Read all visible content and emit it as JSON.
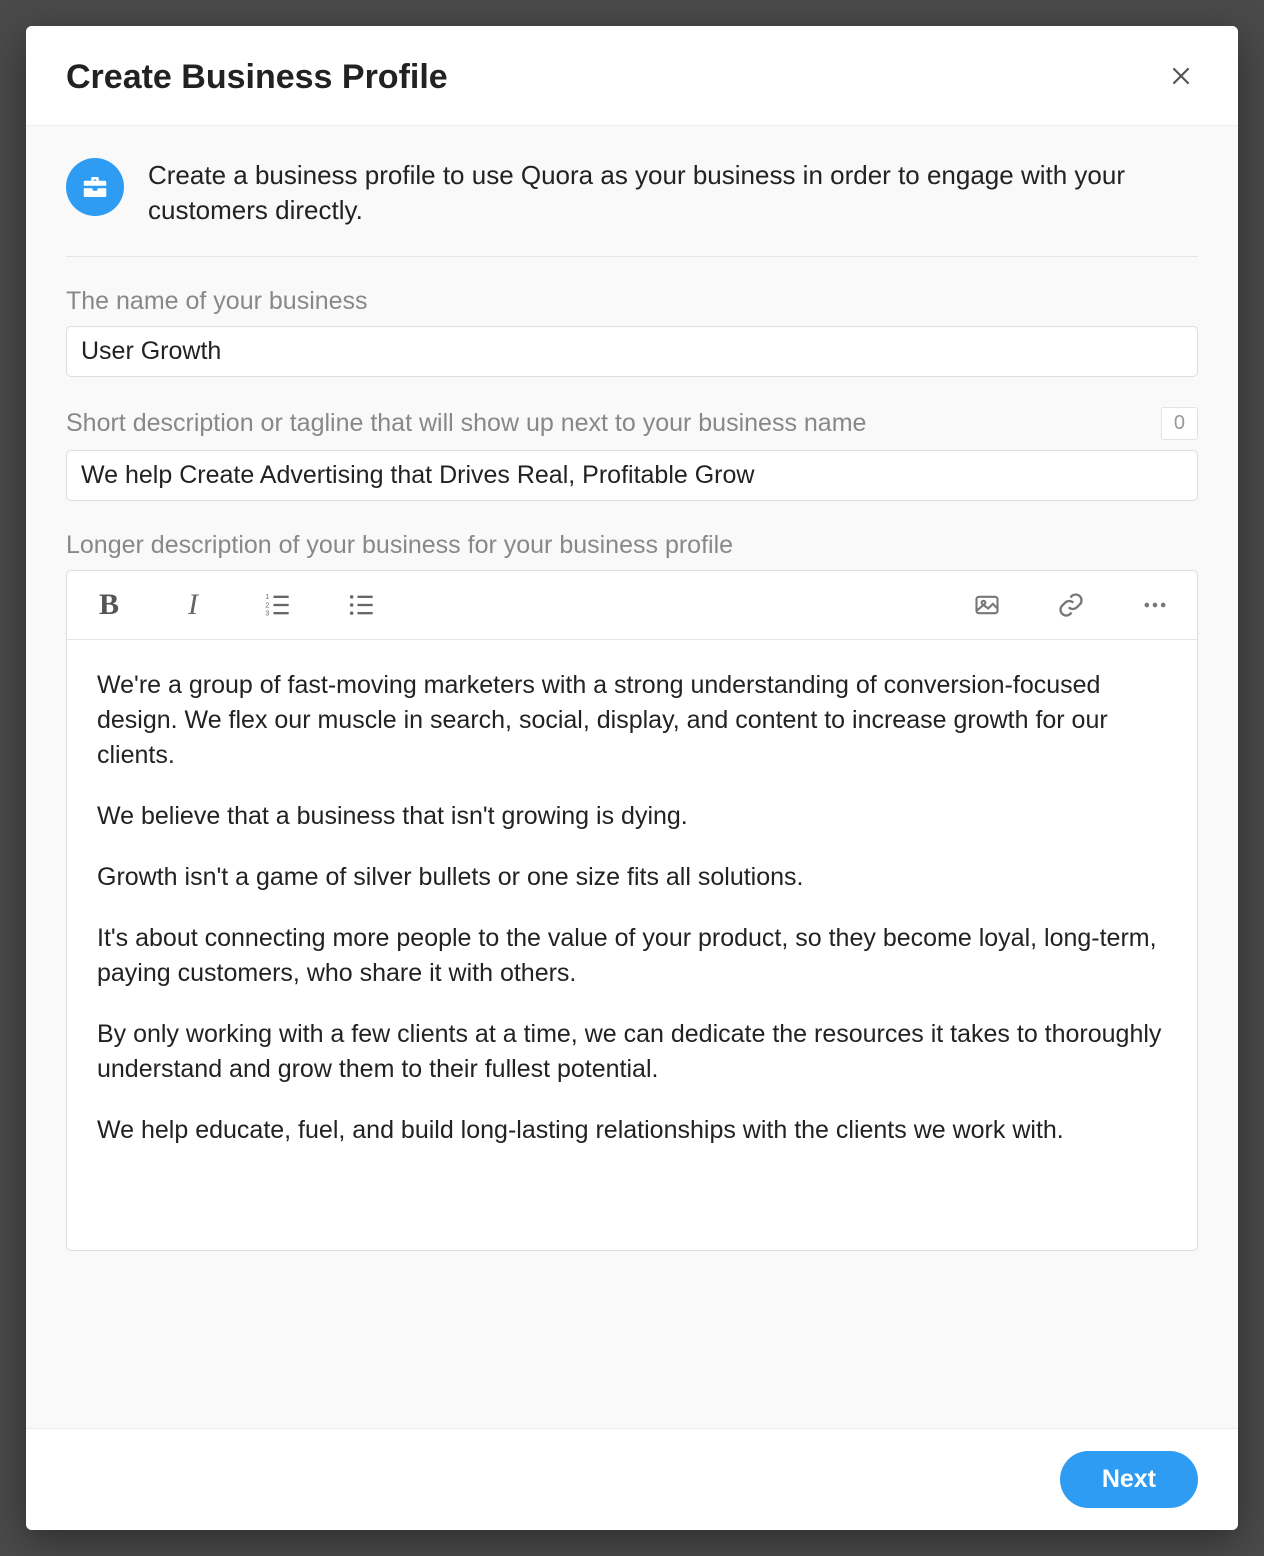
{
  "modal": {
    "title": "Create Business Profile",
    "intro": "Create a business profile to use Quora as your business in order to engage with your customers directly."
  },
  "fields": {
    "name_label": "The name of your business",
    "name_value": "User Growth",
    "tagline_label": "Short description or tagline that will show up next to your business name",
    "tagline_value": "We help Create Advertising that Drives Real, Profitable Grow",
    "tagline_counter": "0",
    "description_label": "Longer description of your business for your business profile"
  },
  "description_paragraphs": {
    "p1": "We're a group of fast-moving marketers with a strong understanding of conversion-focused design. We flex our muscle in search, social, display, and content to increase growth for our clients.",
    "p2": "We believe that a business that isn't growing is dying.",
    "p3": "Growth isn't a game of silver bullets or one size fits all solutions.",
    "p4": "It's about connecting more people to the value of your product, so they become loyal, long-term, paying customers, who share it with others.",
    "p5": "By only working with a few clients at a time, we can dedicate the resources it takes to thoroughly understand and grow them to their fullest potential.",
    "p6": "We help educate, fuel, and build long-lasting relationships with the clients we work with."
  },
  "footer": {
    "next_label": "Next"
  }
}
